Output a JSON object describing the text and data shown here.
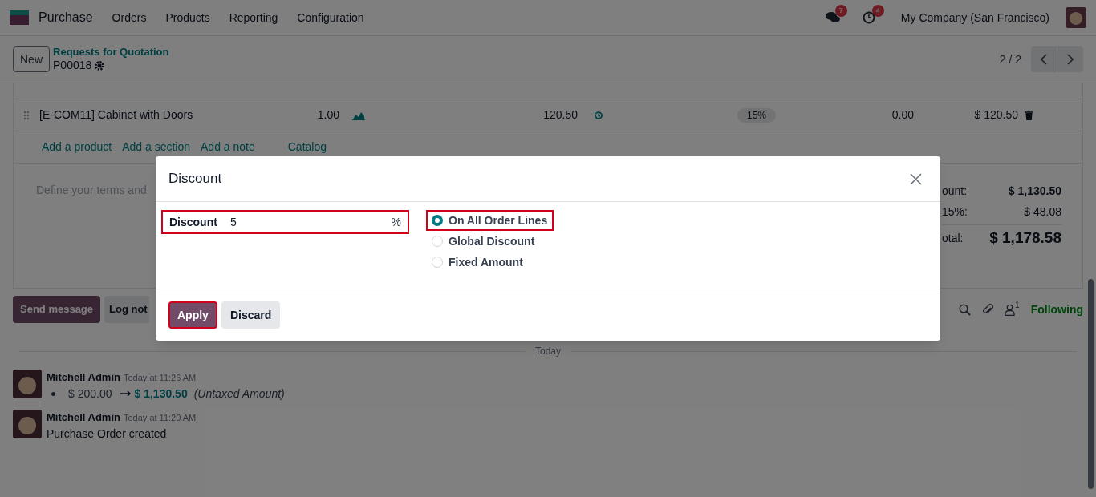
{
  "navbar": {
    "app": "Purchase",
    "menu": [
      "Orders",
      "Products",
      "Reporting",
      "Configuration"
    ],
    "messages_badge": "7",
    "activities_badge": "4",
    "company": "My Company (San Francisco)"
  },
  "control_panel": {
    "new_button": "New",
    "breadcrumb": "Requests for Quotation",
    "record": "P00018",
    "pager": "2 / 2"
  },
  "order_lines": [
    {
      "product": "[E-COM11] Cabinet with Doors",
      "quantity": "1.00",
      "unit_price": "120.50",
      "taxes": "15%",
      "discount": "0.00",
      "subtotal": "$ 120.50"
    }
  ],
  "line_actions": [
    "Add a product",
    "Add a section",
    "Add a note",
    "Catalog"
  ],
  "terms": {
    "placeholder": "Define your terms and"
  },
  "totals": [
    {
      "label": "ount:",
      "value": "$ 1,130.50",
      "kind": "amount"
    },
    {
      "label": "15%:",
      "value": "$ 48.08",
      "kind": "tax"
    },
    {
      "label": "otal:",
      "value": "$ 1,178.58",
      "kind": "total"
    }
  ],
  "chatter": {
    "buttons": [
      "Send message",
      "Log not"
    ],
    "followers_count": "1",
    "follow_label": "Following",
    "date_divider": "Today",
    "messages": [
      {
        "author": "Mitchell Admin",
        "time": "Today at 11:26 AM",
        "kind": "change",
        "old_value": "$ 200.00",
        "new_value": "$ 1,130.50",
        "field": "(Untaxed Amount)"
      },
      {
        "author": "Mitchell Admin",
        "time": "Today at 11:20 AM",
        "kind": "text",
        "body": "Purchase Order created"
      }
    ]
  },
  "dialog": {
    "title": "Discount",
    "field": {
      "label": "Discount",
      "value": "5",
      "unit": "%",
      "highlighted": true
    },
    "options": [
      {
        "label": "On All Order Lines",
        "selected": true,
        "highlighted": true
      },
      {
        "label": "Global Discount",
        "selected": false,
        "highlighted": false
      },
      {
        "label": "Fixed Amount",
        "selected": false,
        "highlighted": false
      }
    ],
    "buttons": [
      {
        "label": "Apply",
        "kind": "primary",
        "highlighted": true
      },
      {
        "label": "Discard",
        "kind": "secondary",
        "highlighted": false
      }
    ]
  }
}
